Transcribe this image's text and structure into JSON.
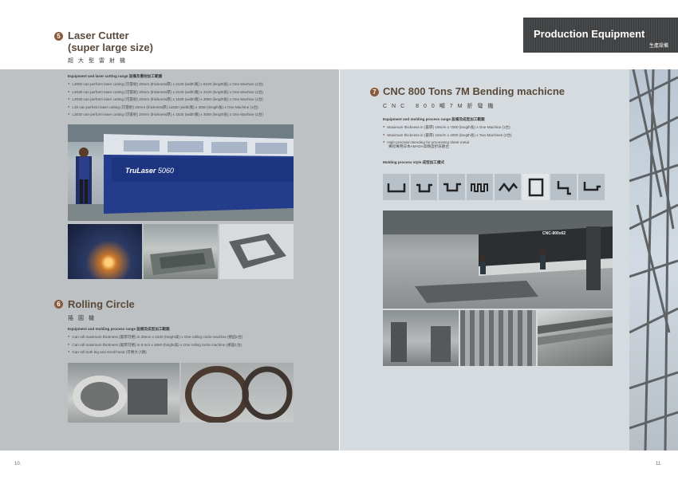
{
  "header": {
    "title": "Production Equipment",
    "subtitle": "生產設備"
  },
  "laser": {
    "number": "5",
    "title_line1": "Laser Cutter",
    "title_line2": "(super large size)",
    "subtitle_cn": "超大型雷射機",
    "range_label": "Equipment and laser cutting range 設備及雷射加工範圍",
    "items": [
      "L3060 can perform laser cutting (可雷射) 20mm (thickness厚) x 2100 (width寬) x 6100 (length長) x One Machine (1台)",
      "L4030 can perform laser cutting (可雷射) 20mm (thickness厚) x 2100 (width寬) x 4100 (length長) x One Machine (1台)",
      "L3030 can perform laser cutting (可雷射) 20mm (thickness厚) x 1530 (width寬) x 3050 (length長) x One Machine (1台)",
      "L25 can perform laser cutting (可雷射) 20mm (thickness厚) x1530 (width寬) x 3050 (length長) x One Machine (1台)",
      "L3030 can perform laser cutting (可雷射) 20mm (thickness厚) x 1530 (width寬) x 3050 (length長) x One Machine (1台)"
    ],
    "machine_brand": "TruLaser",
    "machine_model": "5060"
  },
  "rolling": {
    "number": "6",
    "title": "Rolling Circle",
    "subtitle_cn": "捲圓機",
    "range_label": "Equipment and molding process range 設備及成型加工範圍",
    "items": [
      "Can roll maximum thickness (最厚可捲) in 25mm x 2440 (height高) x One rolling circle machine (捲圓1台)",
      "Can roll maximum thickness (最厚可捲) in 6 mm x 3050 (height高) x One rolling circle machine (捲圓1台)",
      "Can roll both big and small head (可捲大小頭)"
    ]
  },
  "bending": {
    "number": "7",
    "title": "CNC 800 Tons 7M Bending machicne",
    "subtitle_cn": "CNC 800噸7M折彎機",
    "range_label": "Equipment and molding process range 設備及成型加工範圍",
    "items": [
      "Maximum thickness in (最厚) 19m/m x 7000 (length長) x One Machine (1台)",
      "Maximum thickness in (最厚) 16m/m x 4000 (length長) x Two Machines (2台)",
      "High-precision Bending for processing sheet metal"
    ],
    "items_note": "專程專用日本AMADA高精度折床數台",
    "style_label": "Molding process style 成型加工樣式",
    "machine_label": "CNC-800x62"
  },
  "page_numbers": {
    "left": "10.",
    "right": "11."
  }
}
